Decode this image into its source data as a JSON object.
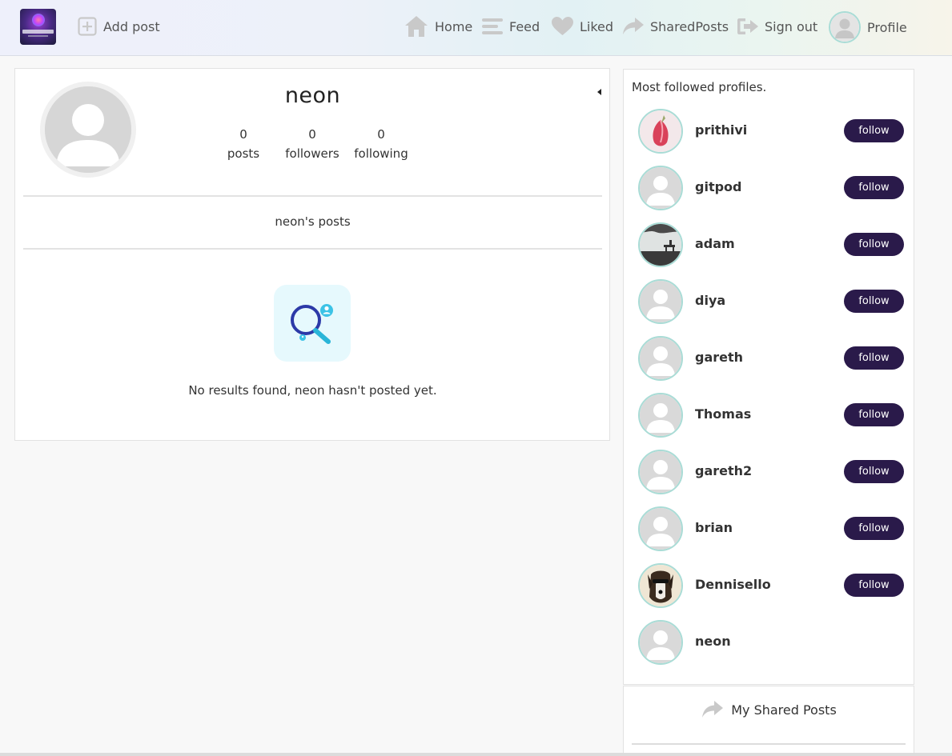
{
  "navbar": {
    "logo_alt": "GrooveMates",
    "add_post": "Add post",
    "home": "Home",
    "feed": "Feed",
    "liked": "Liked",
    "shared_posts": "SharedPosts",
    "sign_out": "Sign out",
    "profile": "Profile",
    "icons": {
      "add_post": "plus-square-icon",
      "home": "home-icon",
      "feed": "menu-lines-icon",
      "liked": "heart-icon",
      "shared": "share-arrow-icon",
      "sign_out": "sign-out-icon"
    }
  },
  "profile": {
    "username": "neon",
    "stats": {
      "posts_count": "0",
      "posts_label": "posts",
      "followers_count": "0",
      "followers_label": "followers",
      "following_count": "0",
      "following_label": "following"
    },
    "posts_heading": "neon's posts",
    "empty_message": "No results found, neon hasn't posted yet."
  },
  "sidebar": {
    "title": "Most followed profiles.",
    "follow_label": "follow",
    "profiles": [
      {
        "name": "prithivi",
        "avatar": "flower",
        "followable": true
      },
      {
        "name": "gitpod",
        "avatar": "default",
        "followable": true
      },
      {
        "name": "adam",
        "avatar": "landscape",
        "followable": true
      },
      {
        "name": "diya",
        "avatar": "default",
        "followable": true
      },
      {
        "name": "gareth",
        "avatar": "default",
        "followable": true
      },
      {
        "name": "Thomas",
        "avatar": "default",
        "followable": true
      },
      {
        "name": "gareth2",
        "avatar": "default",
        "followable": true
      },
      {
        "name": "brian",
        "avatar": "default",
        "followable": true
      },
      {
        "name": "Dennisello",
        "avatar": "dog",
        "followable": true
      },
      {
        "name": "neon",
        "avatar": "default",
        "followable": false
      }
    ]
  },
  "shared_panel": {
    "label": "My Shared Posts"
  },
  "colors": {
    "follow_button": "#2a1a4a",
    "avatar_border": "#a9dcd6",
    "icon_gray": "#c9c9c9",
    "empty_icon_bg": "#e6f9fd"
  }
}
